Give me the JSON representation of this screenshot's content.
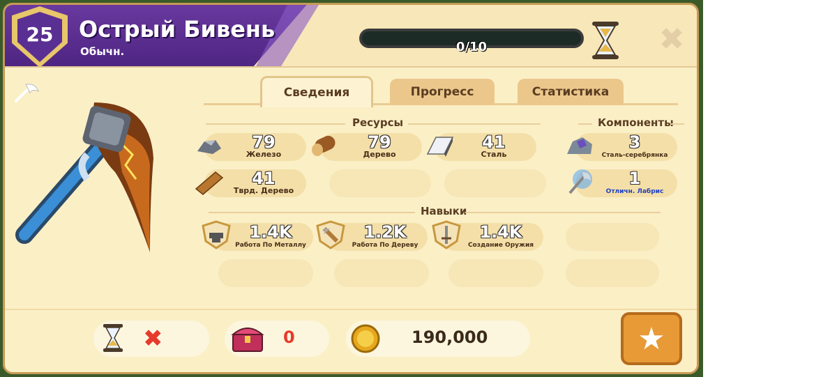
{
  "header": {
    "level": "25",
    "item_name": "Острый Бивень",
    "rarity": "Обычн.",
    "progress_text": "0/10",
    "progress_fraction": 0.0
  },
  "tabs": [
    {
      "label": "Сведения",
      "active": true
    },
    {
      "label": "Прогресс",
      "active": false
    },
    {
      "label": "Статистика",
      "active": false
    }
  ],
  "resources": {
    "title": "Ресурсы",
    "items": [
      {
        "icon": "iron-icon",
        "value": "79",
        "label": "Железо"
      },
      {
        "icon": "wood-icon",
        "value": "79",
        "label": "Дерево"
      },
      {
        "icon": "steel-icon",
        "value": "41",
        "label": "Сталь"
      },
      {
        "icon": "hardwood-icon",
        "value": "41",
        "label": "Тврд. Дерево"
      }
    ]
  },
  "components": {
    "title": "Компоненты",
    "items": [
      {
        "icon": "silversteel-icon",
        "value": "3",
        "label": "Сталь-серебрянка"
      },
      {
        "icon": "labrys-icon",
        "value": "1",
        "label": "Отличн. Лабрис"
      }
    ]
  },
  "skills": {
    "title": "Навыки",
    "items": [
      {
        "icon": "metalwork-icon",
        "value": "1.4K",
        "label": "Работа По Металлу"
      },
      {
        "icon": "woodwork-icon",
        "value": "1.2K",
        "label": "Работа По Дереву"
      },
      {
        "icon": "weaponcraft-icon",
        "value": "1.4K",
        "label": "Создание Оружия"
      }
    ]
  },
  "footer": {
    "price": "190,000",
    "chest_count": "0"
  },
  "colors": {
    "banner": "#5a2f93",
    "panel": "#fbefc6",
    "accent": "#e89a36",
    "cancel_red": "#e53b2d"
  }
}
